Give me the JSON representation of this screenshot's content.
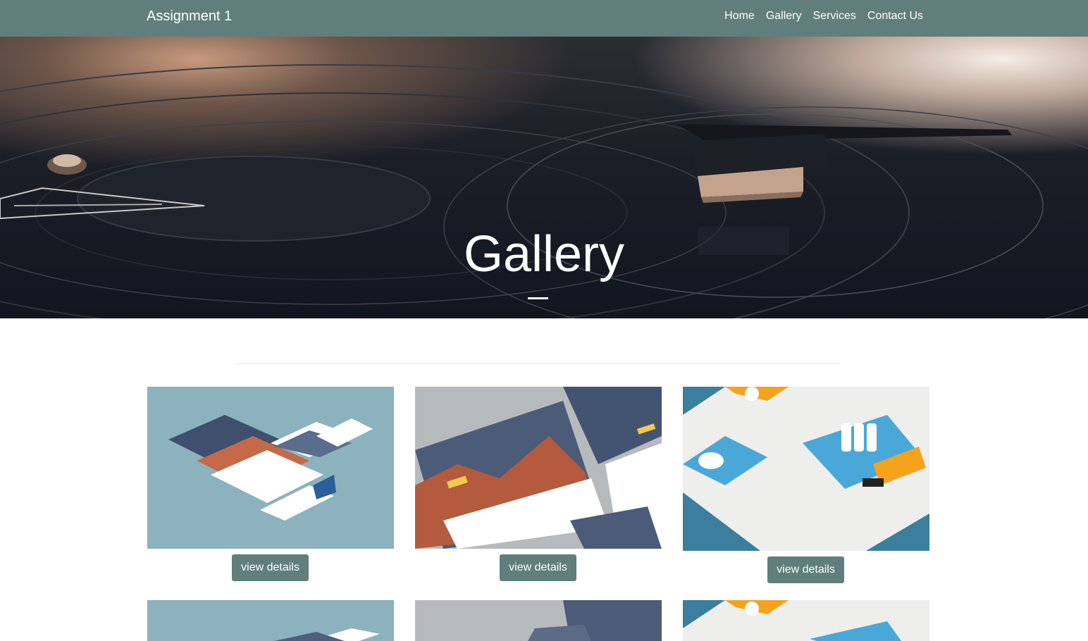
{
  "navbar": {
    "brand": "Assignment 1",
    "links": [
      "Home",
      "Gallery",
      "Services",
      "Contact Us"
    ]
  },
  "hero": {
    "title": "Gallery"
  },
  "gallery": {
    "button_label": "view details",
    "items": [
      {
        "theme": "blue-mockup"
      },
      {
        "theme": "zippy-mockup"
      },
      {
        "theme": "ceramic-mockup"
      },
      {
        "theme": "blue-mockup"
      },
      {
        "theme": "zippy-mockup"
      },
      {
        "theme": "ceramic-mockup"
      }
    ]
  },
  "colors": {
    "navbar": "#607f7c",
    "button": "#607f7c",
    "thumb_blue": "#8bb2bd",
    "thumb_grey": "#b7babd",
    "thumb_teal": "#3c7e9d",
    "accent_orange": "#f5a21d"
  }
}
